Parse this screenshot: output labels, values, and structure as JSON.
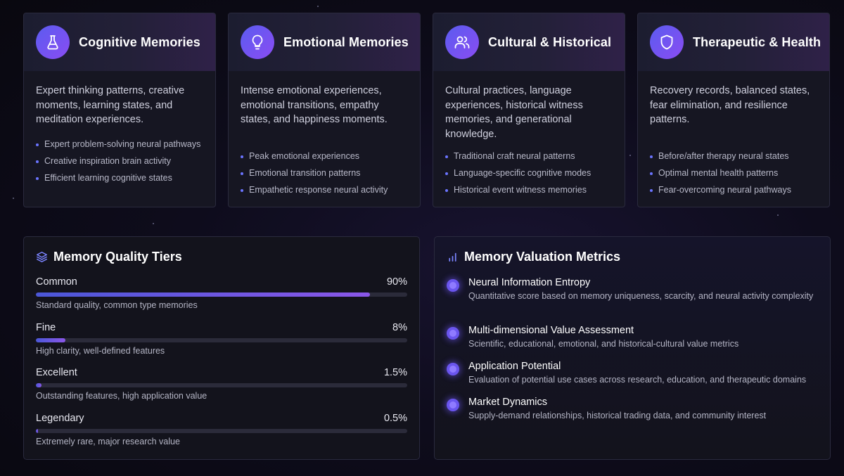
{
  "cards": [
    {
      "title": "Cognitive Memories",
      "icon": "flask-icon",
      "description": "Expert thinking patterns, creative moments, learning states, and meditation experiences.",
      "items": [
        "Expert problem-solving neural pathways",
        "Creative inspiration brain activity",
        "Efficient learning cognitive states"
      ]
    },
    {
      "title": "Emotional Memories",
      "icon": "lightbulb-icon",
      "description": "Intense emotional experiences, emotional transitions, empathy states, and happiness moments.",
      "items": [
        "Peak emotional experiences",
        "Emotional transition patterns",
        "Empathetic response neural activity"
      ]
    },
    {
      "title": "Cultural & Historical",
      "icon": "users-icon",
      "description": "Cultural practices, language experiences, historical witness memories, and generational knowledge.",
      "items": [
        "Traditional craft neural patterns",
        "Language-specific cognitive modes",
        "Historical event witness memories"
      ]
    },
    {
      "title": "Therapeutic & Health",
      "icon": "shield-icon",
      "description": "Recovery records, balanced states, fear elimination, and resilience patterns.",
      "items": [
        "Before/after therapy neural states",
        "Optimal mental health patterns",
        "Fear-overcoming neural pathways"
      ]
    }
  ],
  "tiers_panel": {
    "title": "Memory Quality Tiers",
    "icon": "layers-icon",
    "tiers": [
      {
        "name": "Common",
        "percent_label": "90%",
        "fill": 0.9,
        "description": "Standard quality, common type memories"
      },
      {
        "name": "Fine",
        "percent_label": "8%",
        "fill": 0.08,
        "description": "High clarity, well-defined features"
      },
      {
        "name": "Excellent",
        "percent_label": "1.5%",
        "fill": 0.015,
        "description": "Outstanding features, high application value"
      },
      {
        "name": "Legendary",
        "percent_label": "0.5%",
        "fill": 0.005,
        "description": "Extremely rare, major research value"
      }
    ]
  },
  "metrics_panel": {
    "title": "Memory Valuation Metrics",
    "icon": "bar-chart-icon",
    "metrics": [
      {
        "name": "Neural Information Entropy",
        "description": "Quantitative score based on memory uniqueness, scarcity, and neural activity complexity"
      },
      {
        "name": "Multi-dimensional Value Assessment",
        "description": "Scientific, educational, emotional, and historical-cultural value metrics"
      },
      {
        "name": "Application Potential",
        "description": "Evaluation of potential use cases across research, education, and therapeutic domains"
      },
      {
        "name": "Market Dynamics",
        "description": "Supply-demand relationships, historical trading data, and community interest"
      }
    ]
  },
  "colors": {
    "accent_start": "#5b5cf0",
    "accent_end": "#8a4cf2",
    "bullet": "#6b74ff",
    "bar_track": "#2b2b3a"
  }
}
